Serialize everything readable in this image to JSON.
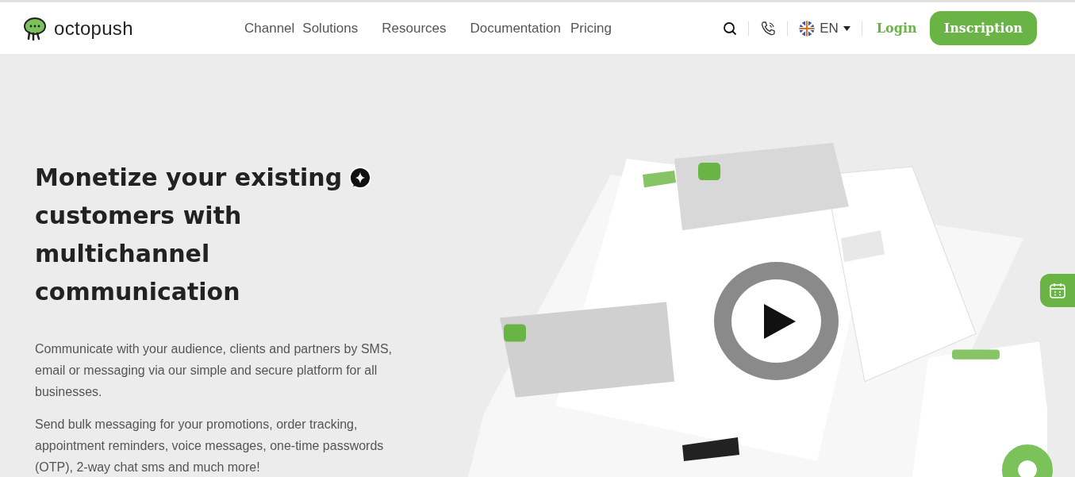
{
  "header": {
    "logo": "octopush",
    "nav": [
      "Channel",
      "Solutions",
      "Resources",
      "Documentation",
      "Pricing"
    ],
    "language": "EN",
    "login": "Login",
    "signup": "Inscription"
  },
  "hero": {
    "heading_lines": [
      "Monetize your existing",
      "customers with",
      "multichannel",
      "communication"
    ],
    "paragraphs": [
      "Communicate with your audience, clients and partners by SMS, email or messaging via our simple and secure platform for all businesses.",
      "Send bulk messaging for your promotions, order tracking, appointment reminders, voice messages, one-time passwords (OTP), 2-way chat sms and much more!"
    ],
    "media": {
      "kind": "picture"
    }
  }
}
